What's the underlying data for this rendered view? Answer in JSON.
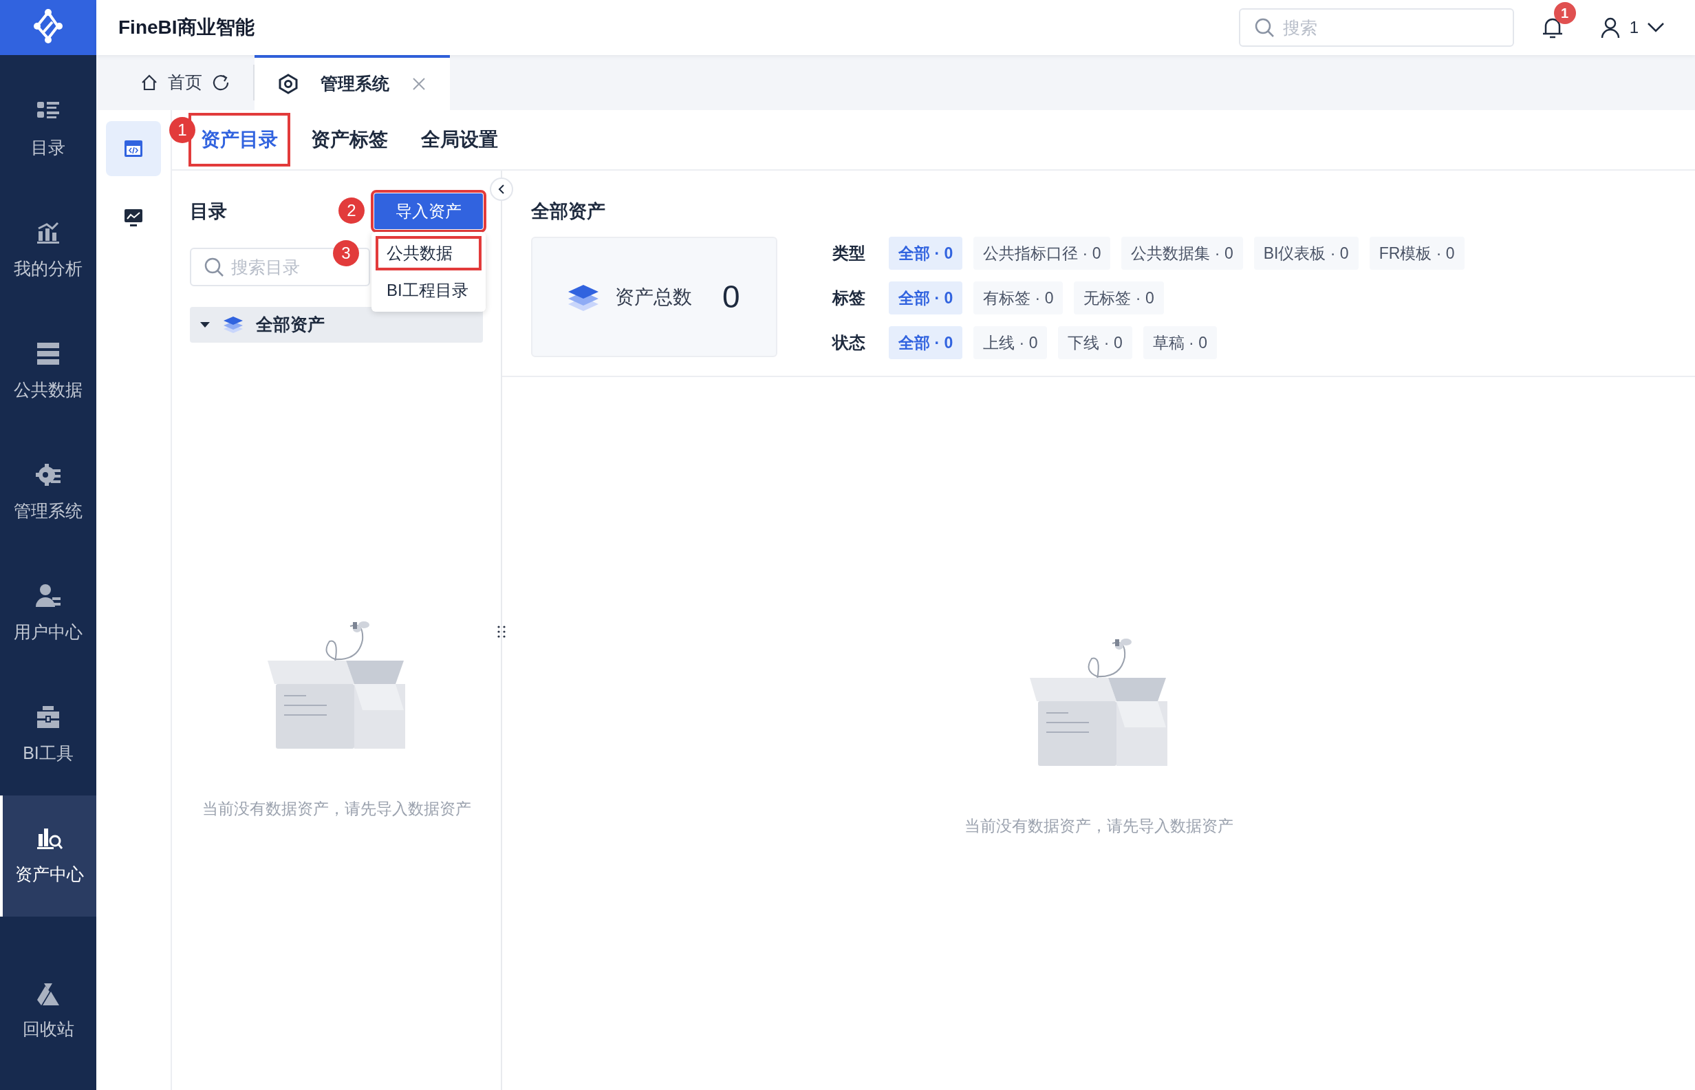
{
  "nav": {
    "items": [
      {
        "label": "目录",
        "selected": false
      },
      {
        "label": "我的分析",
        "selected": false
      },
      {
        "label": "公共数据",
        "selected": false
      },
      {
        "label": "管理系统",
        "selected": false
      },
      {
        "label": "用户中心",
        "selected": false
      },
      {
        "label": "BI工具",
        "selected": false
      },
      {
        "label": "资产中心",
        "selected": true
      }
    ],
    "bottom_item": {
      "label": "回收站"
    }
  },
  "header": {
    "title": "FineBI商业智能",
    "search_placeholder": "搜索",
    "notification_count": "1",
    "user": "1"
  },
  "page_tabs": [
    {
      "label": "首页",
      "kind": "home",
      "selected": false
    },
    {
      "label": "管理系统",
      "kind": "module",
      "selected": true
    }
  ],
  "side_tools": [
    {
      "selected": true
    },
    {
      "selected": false
    }
  ],
  "section_tabs": [
    {
      "label": "资产目录",
      "selected": true,
      "callout": "1"
    },
    {
      "label": "资产标签",
      "selected": false
    },
    {
      "label": "全局设置",
      "selected": false
    }
  ],
  "catalog": {
    "title": "目录",
    "import_button": {
      "label": "导入资产",
      "callout": "2"
    },
    "menu": [
      {
        "label": "公共数据",
        "callout": "3"
      },
      {
        "label": "BI工程目录"
      }
    ],
    "search_placeholder": "搜索目录",
    "tree": [
      {
        "label": "全部资产",
        "expanded": true,
        "selected": true
      }
    ],
    "empty_text": "当前没有数据资产，请先导入数据资产"
  },
  "assets": {
    "title": "全部资产",
    "total_label": "资产总数",
    "total": "0",
    "filters": [
      {
        "label": "类型",
        "options": [
          {
            "label": "全部 · 0",
            "selected": true
          },
          {
            "label": "公共指标口径 · 0",
            "selected": false
          },
          {
            "label": "公共数据集 · 0",
            "selected": false
          },
          {
            "label": "BI仪表板 · 0",
            "selected": false
          },
          {
            "label": "FR模板 · 0",
            "selected": false
          }
        ]
      },
      {
        "label": "标签",
        "options": [
          {
            "label": "全部 · 0",
            "selected": true
          },
          {
            "label": "有标签 · 0",
            "selected": false
          },
          {
            "label": "无标签 · 0",
            "selected": false
          }
        ]
      },
      {
        "label": "状态",
        "options": [
          {
            "label": "全部 · 0",
            "selected": true
          },
          {
            "label": "上线 · 0",
            "selected": false
          },
          {
            "label": "下线 · 0",
            "selected": false
          },
          {
            "label": "草稿 · 0",
            "selected": false
          }
        ]
      }
    ],
    "empty_text": "当前没有数据资产，请先导入数据资产"
  }
}
